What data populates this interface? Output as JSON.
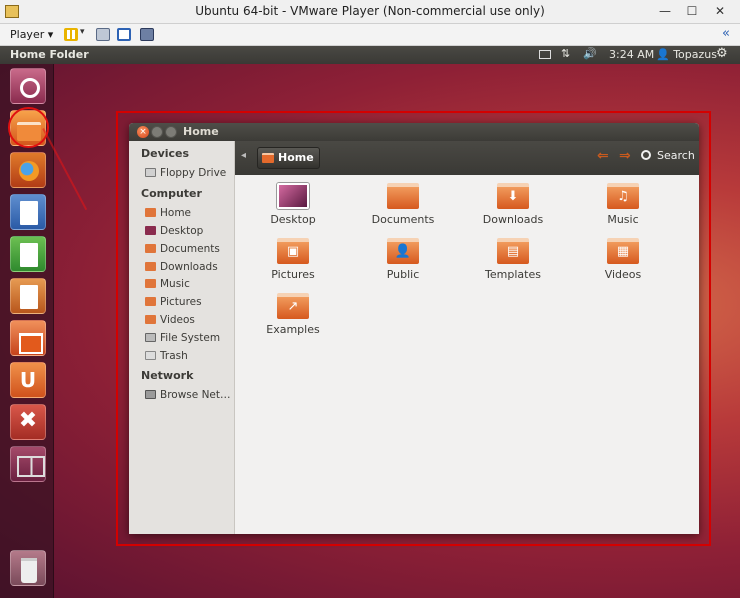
{
  "vm": {
    "title": "Ubuntu 64-bit - VMware Player (Non-commercial use only)",
    "player_menu": "Player",
    "minimize": "—",
    "maximize": "☐",
    "close": "✕",
    "collapse": "«"
  },
  "top_panel": {
    "title": "Home Folder",
    "network_glyph": "⇅",
    "sound_glyph": "🔊",
    "time": "3:24 AM",
    "user": "👤 Topazus",
    "gear_glyph": "⚙"
  },
  "launcher": {
    "ubuntu_one_label": "U",
    "settings_glyph": "✖"
  },
  "nautilus": {
    "title": "Home",
    "close_glyph": "×",
    "path_left": "◂",
    "path_home": "Home",
    "back_glyph": "⇐",
    "forward_glyph": "⇒",
    "search_label": "Search",
    "sidebar": {
      "devices_header": "Devices",
      "devices": [
        "Floppy Drive"
      ],
      "computer_header": "Computer",
      "computer": [
        "Home",
        "Desktop",
        "Documents",
        "Downloads",
        "Music",
        "Pictures",
        "Videos",
        "File System",
        "Trash"
      ],
      "network_header": "Network",
      "network": [
        "Browse Net…"
      ]
    },
    "files": [
      {
        "name": "Desktop",
        "icon": "desktop-icon",
        "glyph": ""
      },
      {
        "name": "Documents",
        "icon": "documents-folder-icon",
        "glyph": ""
      },
      {
        "name": "Downloads",
        "icon": "downloads-folder-icon",
        "glyph": "⬇"
      },
      {
        "name": "Music",
        "icon": "music-folder-icon",
        "glyph": "♫"
      },
      {
        "name": "Pictures",
        "icon": "pictures-folder-icon",
        "glyph": "▣"
      },
      {
        "name": "Public",
        "icon": "public-folder-icon",
        "glyph": "👤"
      },
      {
        "name": "Templates",
        "icon": "templates-folder-icon",
        "glyph": "▤"
      },
      {
        "name": "Videos",
        "icon": "videos-folder-icon",
        "glyph": "▦"
      },
      {
        "name": "Examples",
        "icon": "examples-folder-icon",
        "glyph": "↗"
      }
    ]
  },
  "colors": {
    "accent_orange": "#dd4814",
    "highlight_red": "#d40000"
  }
}
